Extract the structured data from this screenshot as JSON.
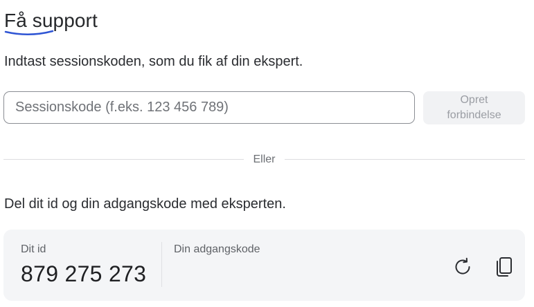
{
  "header": {
    "title": "Få support"
  },
  "session": {
    "instruction": "Indtast sessionskoden, som du fik af din ekspert.",
    "placeholder": "Sessionskode (f.eks. 123 456 789)",
    "connect_label": "Opret forbindelse"
  },
  "divider": {
    "label": "Eller"
  },
  "share": {
    "instruction": "Del dit id og din adgangskode med eksperten.",
    "id_label": "Dit id",
    "id_value": "879 275 273",
    "password_label": "Din adgangskode",
    "refresh_icon": "refresh-icon",
    "copy_icon": "copy-icon"
  },
  "colors": {
    "accent_underline": "#2f55d4",
    "card_background": "#f4f5f7",
    "button_background": "#f1f2f4"
  }
}
